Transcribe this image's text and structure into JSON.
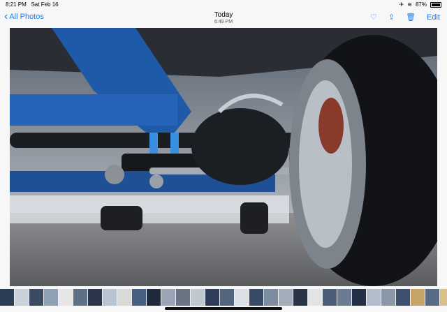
{
  "status": {
    "time": "8:21 PM",
    "date": "Sat Feb 16",
    "battery": "87%"
  },
  "nav": {
    "back_label": "All Photos",
    "title": "Today",
    "subtitle": "6:49 PM",
    "edit_label": "Edit"
  },
  "icons": {
    "back": "chevron-left-icon",
    "favorite": "heart-icon",
    "share": "share-icon",
    "delete": "trash-icon"
  },
  "colors": {
    "accent": "#1a7cf7"
  },
  "thumbnails": [
    "#2c3e55",
    "#c9d1db",
    "#3a4b63",
    "#8fa0b4",
    "#e6e6e6",
    "#5f6f86",
    "#2b364a",
    "#b9c4d2",
    "#d9d9d9",
    "#476082",
    "#1f2b3d",
    "#9aa6b5",
    "#6a7584",
    "#c0c7d1",
    "#2e3d59",
    "#53647d",
    "#dbe0e6",
    "#384a66",
    "#7d8ca0",
    "#a4aebb",
    "#293547",
    "#e3e3e3",
    "#4c5d77",
    "#6b7b93",
    "#233046",
    "#b2bccb",
    "#8a97a8",
    "#3e506d",
    "#c6a366",
    "#5a6b85",
    "#d8c08a",
    "#2f3e58",
    "#9fa9b7",
    "#46587a",
    "#e0e4ea",
    "#1d283a",
    "#7a8799",
    "#bec6d1",
    "#35465f",
    "#6e5a3e",
    "#a8b3c1",
    "#2a3850",
    "#cfd5dd",
    "#58698a",
    "#8292a8",
    "#30405c",
    "#e8e8e8",
    "#4a5a74",
    "#95a2b3",
    "#27354b"
  ]
}
